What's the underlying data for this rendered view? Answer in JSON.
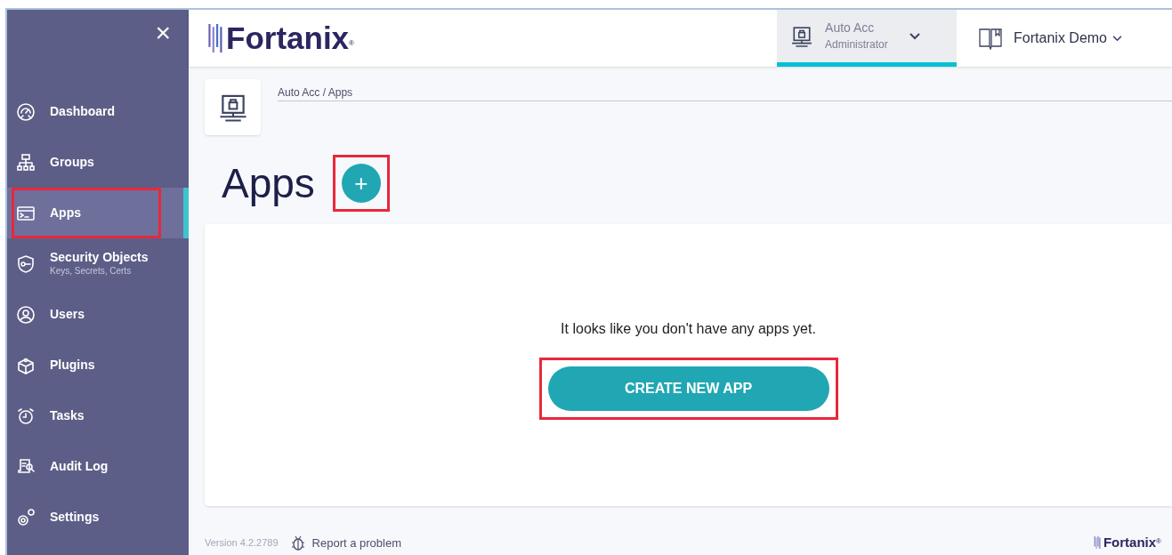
{
  "sidebar": {
    "close": "×",
    "items": [
      {
        "label": "Dashboard",
        "selected": false,
        "highlighted": false
      },
      {
        "label": "Groups",
        "selected": false,
        "highlighted": false
      },
      {
        "label": "Apps",
        "selected": true,
        "highlighted": true
      },
      {
        "label": "Security Objects",
        "subtitle": "Keys, Secrets, Certs",
        "selected": false,
        "highlighted": false
      },
      {
        "label": "Users",
        "selected": false,
        "highlighted": false
      },
      {
        "label": "Plugins",
        "selected": false,
        "highlighted": false
      },
      {
        "label": "Tasks",
        "selected": false,
        "highlighted": false
      },
      {
        "label": "Audit Log",
        "selected": false,
        "highlighted": false
      },
      {
        "label": "Settings",
        "selected": false,
        "highlighted": false
      }
    ]
  },
  "header": {
    "logo": "Fortanix",
    "logo_mark": "®",
    "account": {
      "name": "Auto Acc",
      "role": "Administrator",
      "selected": true
    },
    "org": {
      "name": "Fortanix Demo"
    }
  },
  "breadcrumb": "Auto Acc / Apps",
  "page": {
    "title": "Apps",
    "add_button": {
      "label": "+",
      "highlighted": true
    }
  },
  "empty_state": {
    "message": "It looks like you don't have any apps yet.",
    "button": {
      "label": "CREATE NEW APP",
      "highlighted": true
    }
  },
  "footer": {
    "version": "Version 4.2.2789",
    "report": "Report a problem",
    "logo": "Fortanix",
    "logo_mark": "®"
  }
}
